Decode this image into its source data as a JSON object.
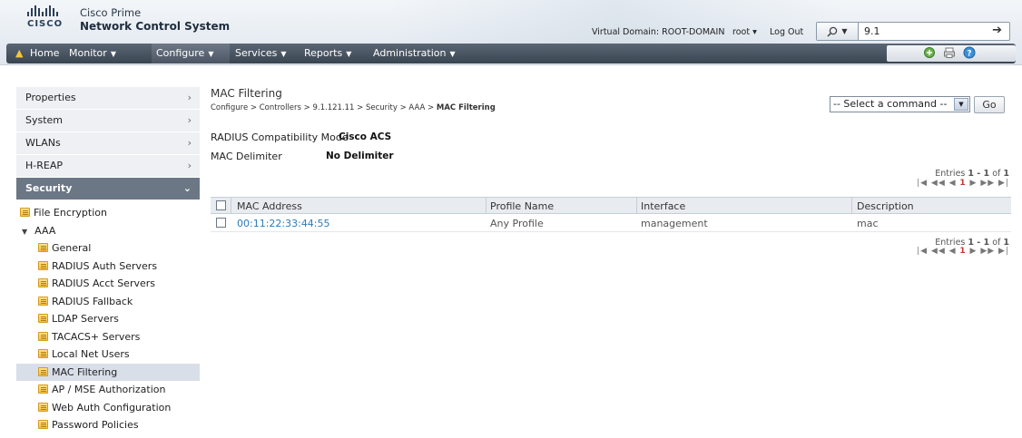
{
  "header": {
    "brand_line1": "Cisco Prime",
    "brand_line2": "Network Control System",
    "logo_word": "CISCO",
    "virtual_domain": "Virtual Domain: ROOT-DOMAIN",
    "user": "root ▾",
    "logout": "Log Out",
    "search_value": "9.1",
    "search_icon": "magnifier-icon",
    "search_go_icon": "arrow-right-icon"
  },
  "nav": {
    "home": "Home",
    "monitor": "Monitor",
    "configure": "Configure",
    "services": "Services",
    "reports": "Reports",
    "administration": "Administration",
    "caret": "▼"
  },
  "sidebar": {
    "sections": [
      {
        "label": "Properties",
        "chev": "›"
      },
      {
        "label": "System",
        "chev": "›"
      },
      {
        "label": "WLANs",
        "chev": "›"
      },
      {
        "label": "H-REAP",
        "chev": "›"
      },
      {
        "label": "Security",
        "chev": "⌄"
      }
    ],
    "file_encryption": "File Encryption",
    "aaa": "AAA",
    "aaa_items": [
      "General",
      "RADIUS Auth Servers",
      "RADIUS Acct Servers",
      "RADIUS Fallback",
      "LDAP Servers",
      "TACACS+ Servers",
      "Local Net Users",
      "MAC Filtering"
    ],
    "after_items": [
      "AP / MSE Authorization",
      "Web Auth Configuration",
      "Password Policies"
    ]
  },
  "main": {
    "title": "MAC Filtering",
    "breadcrumb_prefix": "Configure  >  Controllers  >  9.1.121.11  >  Security  >  AAA  > ",
    "breadcrumb_current": "MAC Filtering",
    "command_select": "-- Select a command --",
    "go_label": "Go",
    "radius_label": "RADIUS Compatibility Mode",
    "radius_value": "Cisco ACS",
    "mac_delim_label": "MAC Delimiter",
    "mac_delim_value": "No Delimiter",
    "entries_prefix": "Entries ",
    "entries_range": "1 - 1",
    "entries_of": " of ",
    "entries_total": "1",
    "pager_left": "|◀ ◀◀ ◀ ",
    "pager_current": "1",
    "pager_right": " ▶ ▶▶ ▶|"
  },
  "table": {
    "headers": [
      "MAC Address",
      "Profile Name",
      "Interface",
      "Description"
    ],
    "rows": [
      {
        "mac": "00:11:22:33:44:55",
        "profile": "Any Profile",
        "interface": "management",
        "description": "mac"
      }
    ]
  },
  "colors": {
    "nav_bg": "#3a4552",
    "link": "#2b7bb9",
    "active_section": "#6c7785",
    "pager_current": "#c0392b"
  }
}
